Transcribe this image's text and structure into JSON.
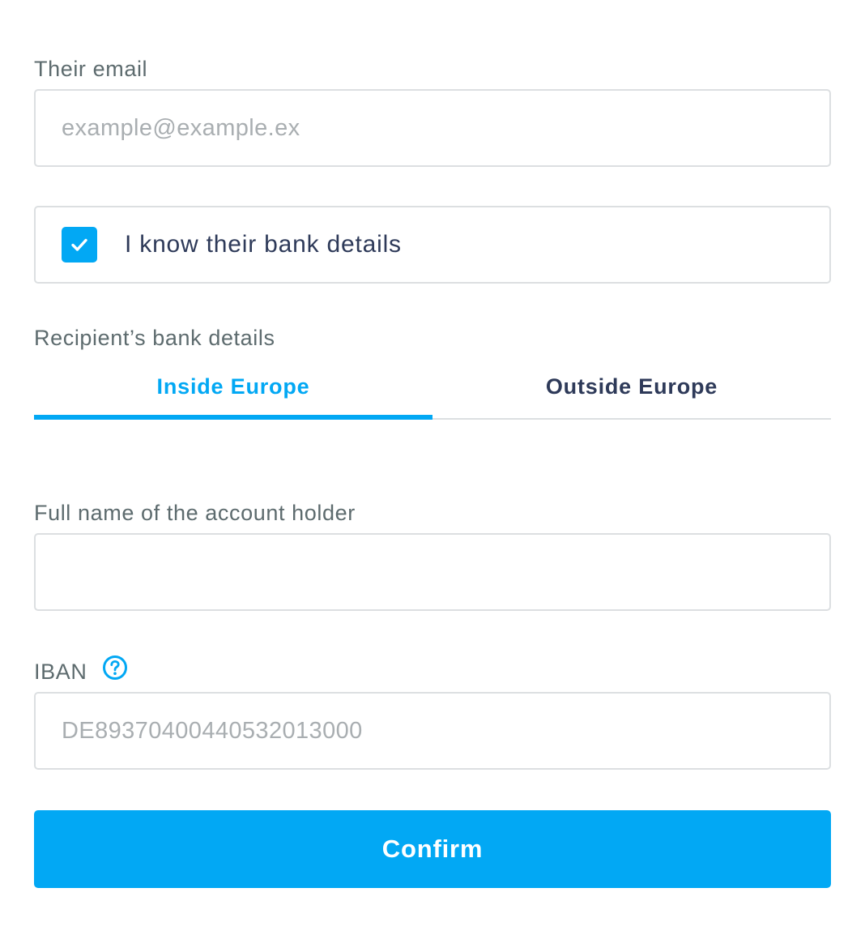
{
  "email": {
    "label": "Their email",
    "value": "",
    "placeholder": "example@example.ex"
  },
  "bank_details_checkbox": {
    "label": "I know their bank details",
    "checked": true,
    "icon": "checkmark-icon"
  },
  "bank_details": {
    "label": "Recipient’s bank details",
    "tabs": [
      {
        "label": "Inside Europe",
        "active": true
      },
      {
        "label": "Outside Europe",
        "active": false
      }
    ]
  },
  "account_holder": {
    "label": "Full name of the account holder",
    "value": "",
    "placeholder": ""
  },
  "iban": {
    "label": "IBAN",
    "help_icon": "question-circle-icon",
    "value": "",
    "placeholder": "DE89370400440532013000"
  },
  "confirm_button": {
    "label": "Confirm"
  },
  "colors": {
    "accent": "#02a8f4",
    "text_dark": "#2e3a59",
    "label": "#5d6b6e",
    "border": "#dcdfe1",
    "placeholder": "#a9aeb1"
  }
}
